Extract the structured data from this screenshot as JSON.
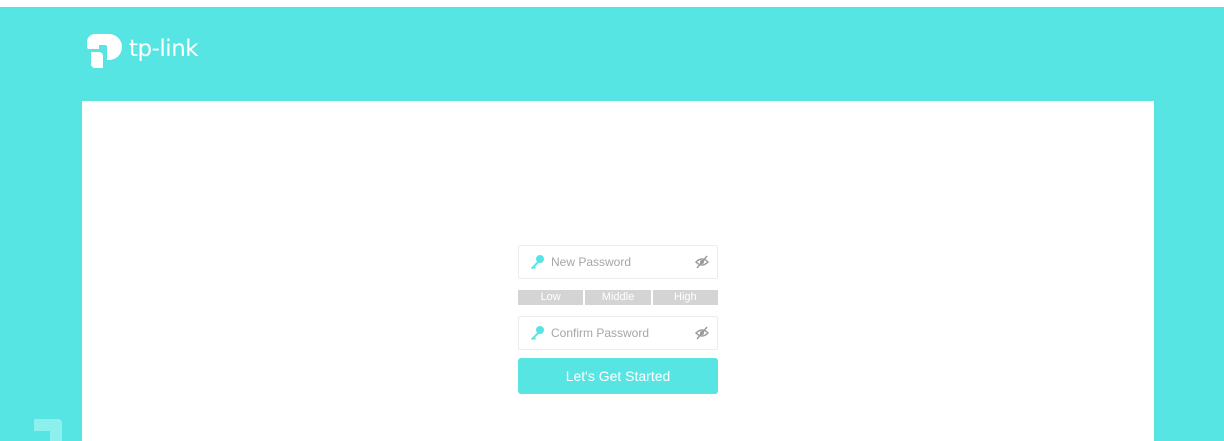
{
  "brand": {
    "logo_text": "tp-link",
    "icon": "tp-link-logo-icon"
  },
  "colors": {
    "accent": "#57e5e3",
    "field_border": "#ececec",
    "strength_bar": "#d4d4d4",
    "icon_key": "#57e5e3",
    "icon_eye": "#9a9a9a"
  },
  "form": {
    "new_password": {
      "placeholder": "New Password",
      "value": "",
      "leading_icon": "key-icon",
      "trailing_icon": "eye-hidden-icon"
    },
    "strength_levels": [
      "Low",
      "Middle",
      "High"
    ],
    "confirm_password": {
      "placeholder": "Confirm Password",
      "value": "",
      "leading_icon": "key-icon",
      "trailing_icon": "eye-hidden-icon"
    },
    "submit_label": "Let's Get Started"
  }
}
